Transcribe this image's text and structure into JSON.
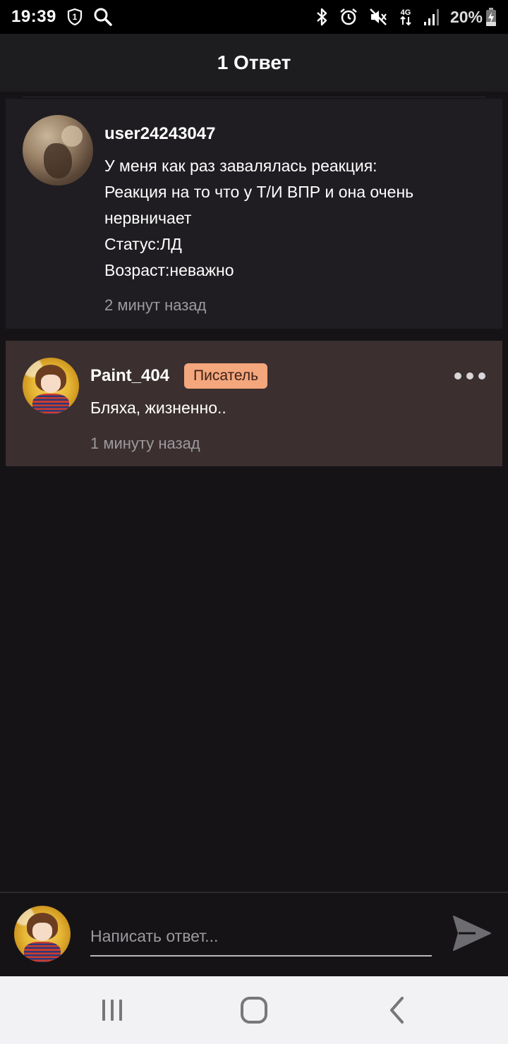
{
  "status_bar": {
    "time": "19:39",
    "battery": "20%",
    "icons": [
      "shield-1-icon",
      "search-icon",
      "bluetooth-icon",
      "alarm-icon",
      "mute-icon",
      "4g-icon",
      "signal-icon",
      "battery-charging-icon"
    ]
  },
  "header": {
    "title": "1 Ответ"
  },
  "comment": {
    "username": "user24243047",
    "text": "У меня как раз завалялась реакция:\nРеакция на то что у Т/И ВПР и она очень\nнервничает\nСтатус:ЛД\nВозраст:неважно",
    "time": "2 минут назад"
  },
  "reply": {
    "username": "Paint_404",
    "badge": "Писатель",
    "text": "Бляха, жизненно..",
    "time": "1 минуту назад"
  },
  "input": {
    "placeholder": "Написать ответ..."
  },
  "colors": {
    "background": "#151316",
    "card": "#1f1d21",
    "reply_card": "#3b2f2f",
    "badge": "#f4a67c",
    "navbar": "#f2f1f4"
  }
}
